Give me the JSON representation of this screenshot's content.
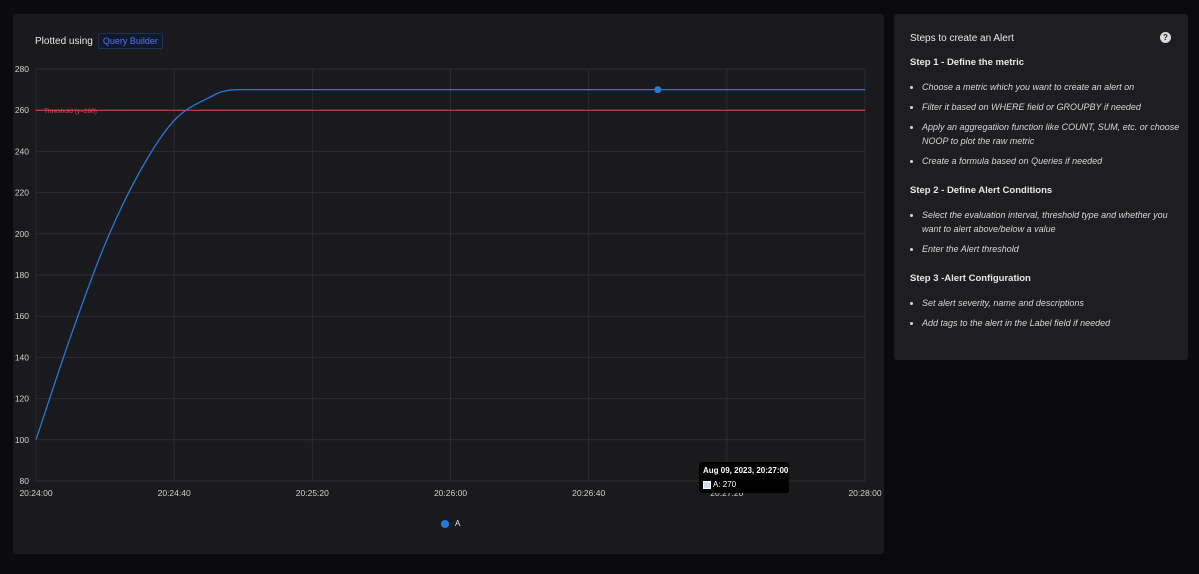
{
  "plot_header": {
    "prefix": "Plotted using",
    "tag": "Query Builder"
  },
  "chart_data": {
    "type": "line",
    "x_ticks": [
      "20:24:00",
      "20:24:40",
      "20:25:20",
      "20:26:00",
      "20:26:40",
      "20:27:20",
      "20:28:00"
    ],
    "y_ticks": [
      80,
      100,
      120,
      140,
      160,
      180,
      200,
      220,
      240,
      260,
      280
    ],
    "ylim": [
      80,
      280
    ],
    "xlim_seconds_label": [
      "20:24:00",
      "20:28:00"
    ],
    "series": [
      {
        "name": "A",
        "color": "#1f7ae0",
        "x": [
          "20:24:00",
          "20:24:10",
          "20:24:20",
          "20:24:30",
          "20:24:40",
          "20:24:50",
          "20:24:58",
          "20:25:20",
          "20:26:00",
          "20:26:40",
          "20:27:00",
          "20:27:20",
          "20:28:00"
        ],
        "values": [
          100,
          150,
          195,
          230,
          255,
          266,
          270,
          270,
          270,
          270,
          270,
          270,
          270
        ]
      }
    ],
    "threshold": {
      "label": "Threshold (y=260)",
      "value": 260,
      "color": "#e5484d"
    },
    "highlight": {
      "x": "20:27:00",
      "value": 270
    },
    "grid": true,
    "legend": "bottom-center"
  },
  "tooltip": {
    "date": "Aug 09, 2023, 20:27:00",
    "value_label": "A: 270"
  },
  "legend": {
    "label": "A"
  },
  "guide": {
    "title": "Steps to create an Alert",
    "help": "?",
    "step1": {
      "title": "Step 1 - Define the metric",
      "items": [
        "Choose a metric which you want to create an alert on",
        "Filter it based on WHERE field or GROUPBY if needed",
        "Apply an aggregatiion function like COUNT, SUM, etc. or choose NOOP to plot the raw metric",
        "Create a formula based on Queries if needed"
      ]
    },
    "step2": {
      "title": "Step 2 - Define Alert Conditions",
      "items": [
        "Select the evaluation interval, threshold type and whether you want to alert above/below a value",
        "Enter the Alert threshold"
      ]
    },
    "step3": {
      "title": "Step 3 -Alert Configuration",
      "items": [
        "Set alert severity, name and descriptions",
        "Add tags to the alert in the Label field if needed"
      ]
    }
  }
}
